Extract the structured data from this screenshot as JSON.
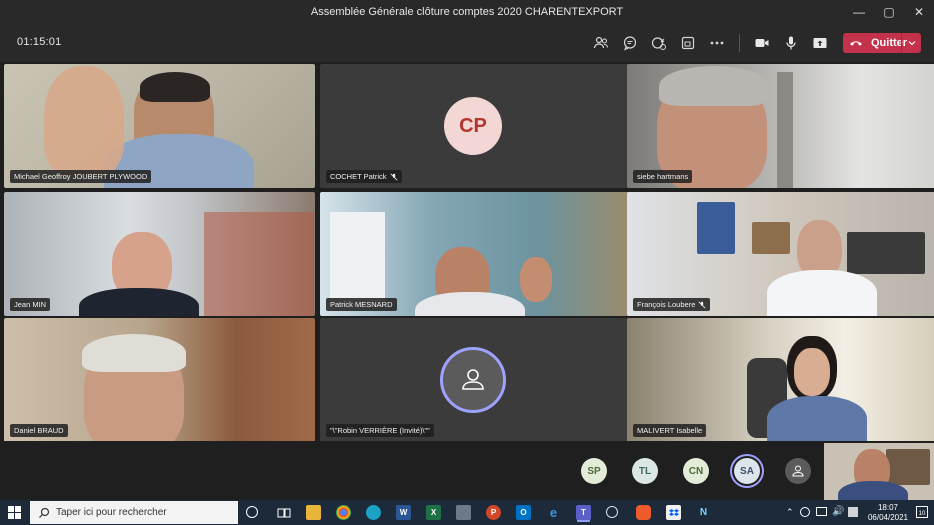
{
  "window": {
    "title": "Assemblée Générale clôture comptes 2020 CHARENTEXPORT",
    "minimize_glyph": "—",
    "maximize_glyph": "▢",
    "close_glyph": "✕"
  },
  "meeting": {
    "timer": "01:15:01",
    "leave_label": "Quitter",
    "toolbar_icons": [
      "participants-icon",
      "chat-icon",
      "reactions-icon",
      "rooms-icon",
      "more-icon",
      "camera-icon",
      "mic-icon",
      "share-icon"
    ]
  },
  "tiles": [
    {
      "name": "Michael Geoffroy JOUBERT PLYWOOD",
      "muted": false
    },
    {
      "name": "COCHET Patrick",
      "muted": true,
      "initials": "CP"
    },
    {
      "name": "siebe hartmans",
      "muted": false
    },
    {
      "name": "Jean MIN",
      "muted": false
    },
    {
      "name": "Patrick MESNARD",
      "muted": false
    },
    {
      "name": "François Loubere",
      "muted": true
    },
    {
      "name": "Daniel BRAUD",
      "muted": false
    },
    {
      "name": "\"\\\"Robin VERRIÈRE (Invité)\\\"\"",
      "muted": false
    },
    {
      "name": "MALIVERT Isabelle",
      "muted": false
    }
  ],
  "participants_strip": [
    {
      "initials": "SP",
      "bg": "#e3ecd9",
      "fg": "#4d6b34"
    },
    {
      "initials": "TL",
      "bg": "#dbe7e4",
      "fg": "#3d6b62"
    },
    {
      "initials": "CN",
      "bg": "#e3ecd9",
      "fg": "#4d6b34"
    },
    {
      "initials": "SA",
      "bg": "#dde4ec",
      "fg": "#3d4f6b"
    }
  ],
  "taskbar": {
    "search_placeholder": "Taper ici pour rechercher",
    "time": "18:07",
    "date": "06/04/2021",
    "notif_count": "10"
  },
  "colors": {
    "accent": "#6264a7",
    "leave": "#c4314b"
  }
}
